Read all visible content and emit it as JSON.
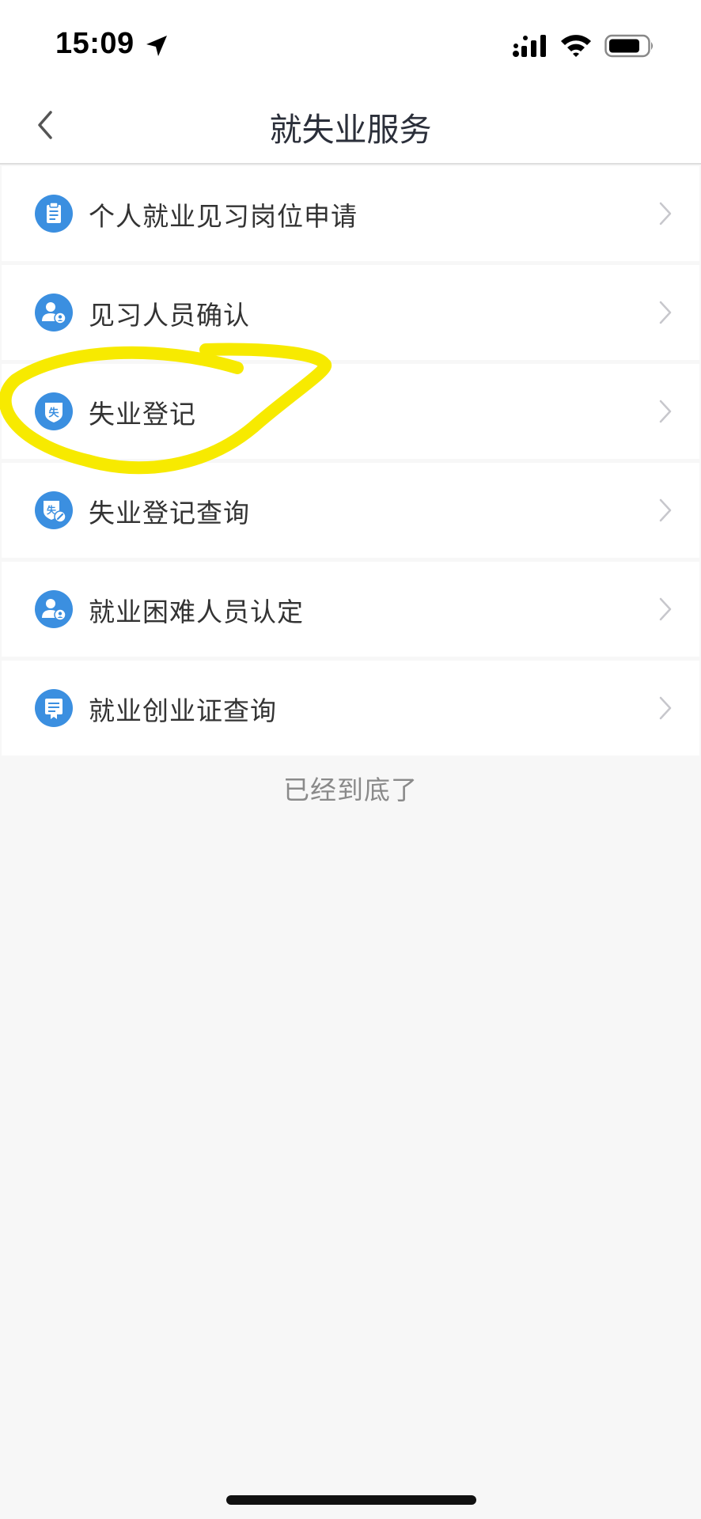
{
  "status_bar": {
    "time": "15:09"
  },
  "nav": {
    "title": "就失业服务"
  },
  "list": {
    "items": [
      {
        "label": "个人就业见习岗位申请",
        "icon": "clipboard-icon"
      },
      {
        "label": "见习人员确认",
        "icon": "person-badge-icon"
      },
      {
        "label": "失业登记",
        "icon": "unemployment-shield-icon",
        "icon_char": "失"
      },
      {
        "label": "失业登记查询",
        "icon": "unemployment-search-icon",
        "icon_char": "失"
      },
      {
        "label": "就业困难人员认定",
        "icon": "person-badge-icon"
      },
      {
        "label": "就业创业证查询",
        "icon": "certificate-icon"
      }
    ]
  },
  "footer": {
    "end_text": "已经到底了"
  },
  "colors": {
    "icon_blue": "#3b8fe0",
    "annotation_yellow": "#f7ea00",
    "title_text": "#2b2f3a",
    "item_text": "#333333",
    "muted_text": "#8a8a8a"
  }
}
